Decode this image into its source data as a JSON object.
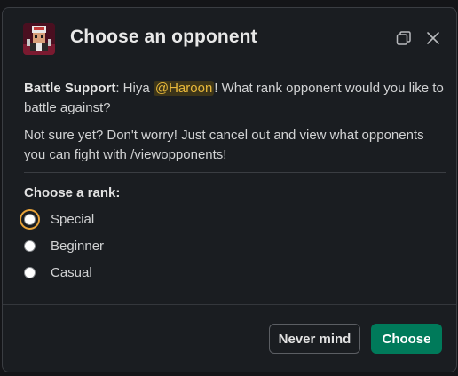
{
  "modal": {
    "title": "Choose an opponent",
    "icons": {
      "app": "battle-bot-avatar",
      "popout": "popout-icon",
      "close": "close-icon"
    }
  },
  "message": {
    "sender": "Battle Support",
    "separator": ": Hiya ",
    "mention": "@Haroon",
    "rest": "! What rank opponent would you like to battle against?",
    "hint": "Not sure yet? Don't worry! Just cancel out and view what opponents you can fight with /viewopponents!"
  },
  "form": {
    "label": "Choose a rank:",
    "options": [
      {
        "label": "Special",
        "focused": true
      },
      {
        "label": "Beginner",
        "focused": false
      },
      {
        "label": "Casual",
        "focused": false
      }
    ]
  },
  "footer": {
    "cancel_label": "Never mind",
    "submit_label": "Choose"
  },
  "colors": {
    "background": "#1a1d21",
    "accent": "#007a5a",
    "mention_text": "#e8b83a",
    "focus_ring": "#e8a33a"
  }
}
